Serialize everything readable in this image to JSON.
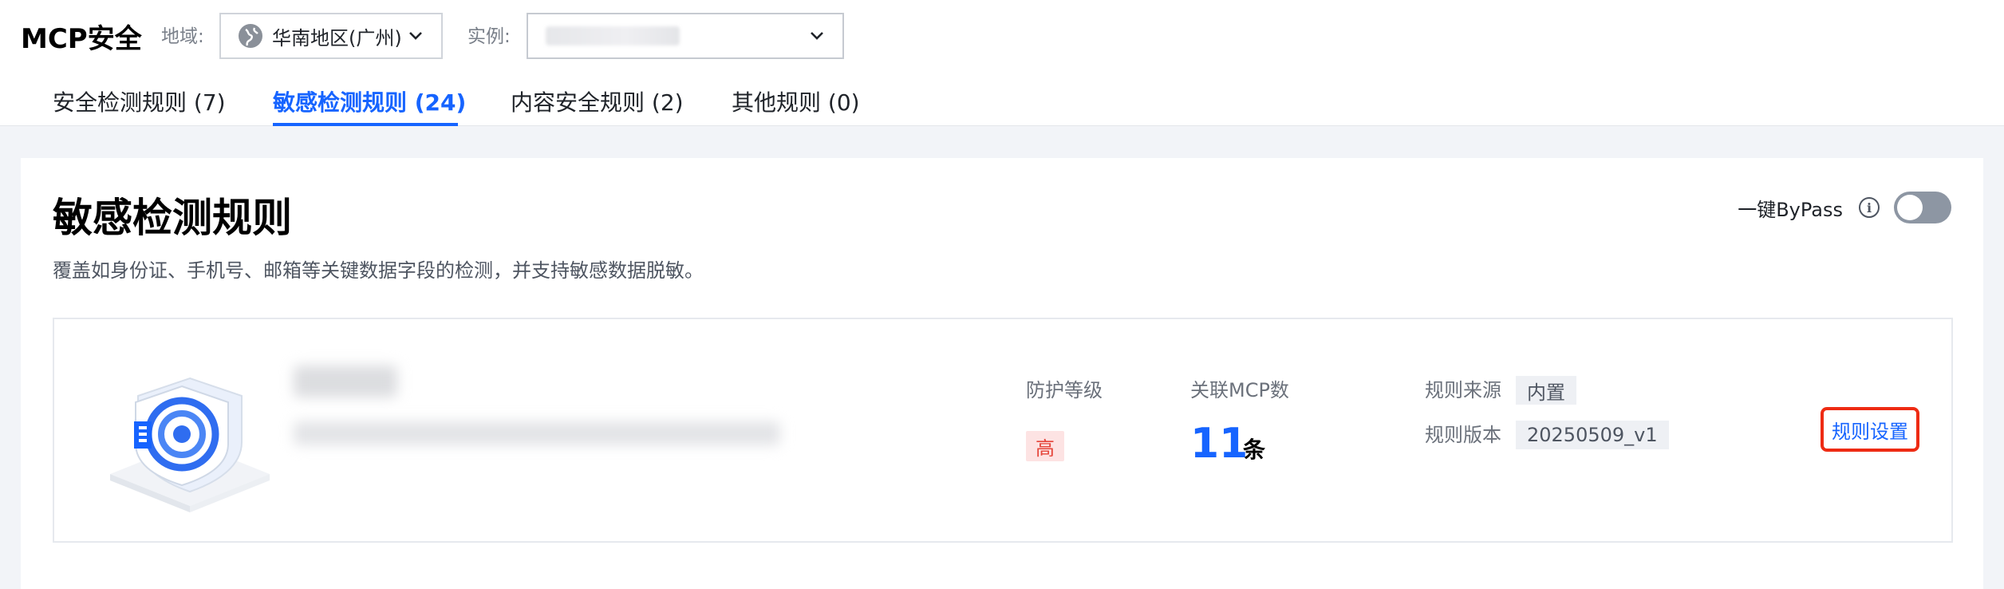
{
  "header": {
    "title": "MCP安全",
    "region_label": "地域:",
    "region_value": "华南地区(广州)",
    "instance_label": "实例:"
  },
  "tabs": [
    {
      "label": "安全检测规则 (7)",
      "active": false
    },
    {
      "label": "敏感检测规则 (24)",
      "active": true
    },
    {
      "label": "内容安全规则 (2)",
      "active": false
    },
    {
      "label": "其他规则 (0)",
      "active": false
    }
  ],
  "section": {
    "title": "敏感检测规则",
    "description": "覆盖如身份证、手机号、邮箱等关键数据字段的检测，并支持敏感数据脱敏。",
    "bypass_label": "一键ByPass",
    "bypass_enabled": false
  },
  "rule": {
    "protection_level_label": "防护等级",
    "protection_level_value": "高",
    "mcp_count_label": "关联MCP数",
    "mcp_count_value": "11",
    "mcp_count_unit": "条",
    "source_label": "规则来源",
    "source_value": "内置",
    "version_label": "规则版本",
    "version_value": "20250509_v1",
    "settings_label": "规则设置"
  },
  "colors": {
    "accent": "#1664ff",
    "danger": "#e5453a",
    "danger_bg": "#fde3e3",
    "highlight_border": "#ee2b13"
  },
  "icons": [
    "globe-icon",
    "chevron-down-icon",
    "info-icon",
    "shield-illustration"
  ]
}
